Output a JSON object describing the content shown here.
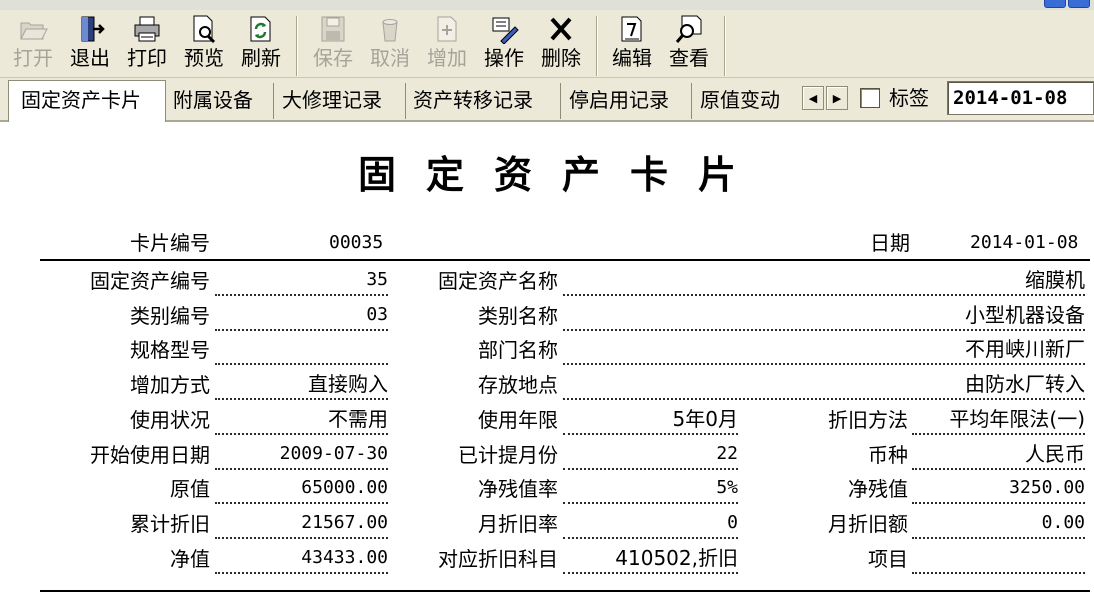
{
  "toolbar": {
    "items": [
      {
        "label": "打开",
        "icon": "folder-open-icon",
        "enabled": false
      },
      {
        "label": "退出",
        "icon": "exit-door-icon",
        "enabled": true
      },
      {
        "label": "打印",
        "icon": "printer-icon",
        "enabled": true
      },
      {
        "label": "预览",
        "icon": "print-preview-icon",
        "enabled": true
      },
      {
        "label": "刷新",
        "icon": "refresh-icon",
        "enabled": true
      },
      {
        "label": "保存",
        "icon": "save-disk-icon",
        "enabled": false
      },
      {
        "label": "取消",
        "icon": "cancel-bucket-icon",
        "enabled": false
      },
      {
        "label": "增加",
        "icon": "add-document-icon",
        "enabled": false
      },
      {
        "label": "操作",
        "icon": "operate-pencil-icon",
        "enabled": true
      },
      {
        "label": "删除",
        "icon": "delete-x-icon",
        "enabled": true
      },
      {
        "label": "编辑",
        "icon": "edit-document-icon",
        "enabled": true
      },
      {
        "label": "查看",
        "icon": "view-magnifier-icon",
        "enabled": true
      }
    ]
  },
  "tabs": [
    "固定资产卡片",
    "附属设备",
    "大修理记录",
    "资产转移记录",
    "停启用记录",
    "原值变动"
  ],
  "tab_controls": {
    "tag_label": "标签",
    "tag_checked": false,
    "date": "2014-01-08"
  },
  "card": {
    "title": "固定资产卡片",
    "card_no_label": "卡片编号",
    "card_no": "00035",
    "date_label": "日期",
    "date": "2014-01-08",
    "rows": [
      {
        "l1": "固定资产编号",
        "v1": "35",
        "l2": "固定资产名称",
        "v2": "缩膜机"
      },
      {
        "l1": "类别编号",
        "v1": "03",
        "l2": "类别名称",
        "v2": "小型机器设备"
      },
      {
        "l1": "规格型号",
        "v1": "",
        "l2": "部门名称",
        "v2": "不用峡川新厂"
      },
      {
        "l1": "增加方式",
        "v1": "直接购入",
        "l2": "存放地点",
        "v2": "由防水厂转入"
      },
      {
        "l1": "使用状况",
        "v1": "不需用",
        "l2": "使用年限",
        "v2": "5年0月",
        "l3": "折旧方法",
        "v3": "平均年限法(一)"
      },
      {
        "l1": "开始使用日期",
        "v1": "2009-07-30",
        "l2": "已计提月份",
        "v2": "22",
        "l3": "币种",
        "v3": "人民币"
      },
      {
        "l1": "原值",
        "v1": "65000.00",
        "l2": "净残值率",
        "v2": "5%",
        "l3": "净残值",
        "v3": "3250.00"
      },
      {
        "l1": "累计折旧",
        "v1": "21567.00",
        "l2": "月折旧率",
        "v2": "0",
        "l3": "月折旧额",
        "v3": "0.00"
      },
      {
        "l1": "净值",
        "v1": "43433.00",
        "l2": "对应折旧科目",
        "v2": "410502,折旧",
        "l3": "项目",
        "v3": ""
      }
    ]
  },
  "colors": {
    "toolbar_bg": "#ece9d8",
    "disabled_text": "#a6a499",
    "card_bg": "#ffffff"
  }
}
